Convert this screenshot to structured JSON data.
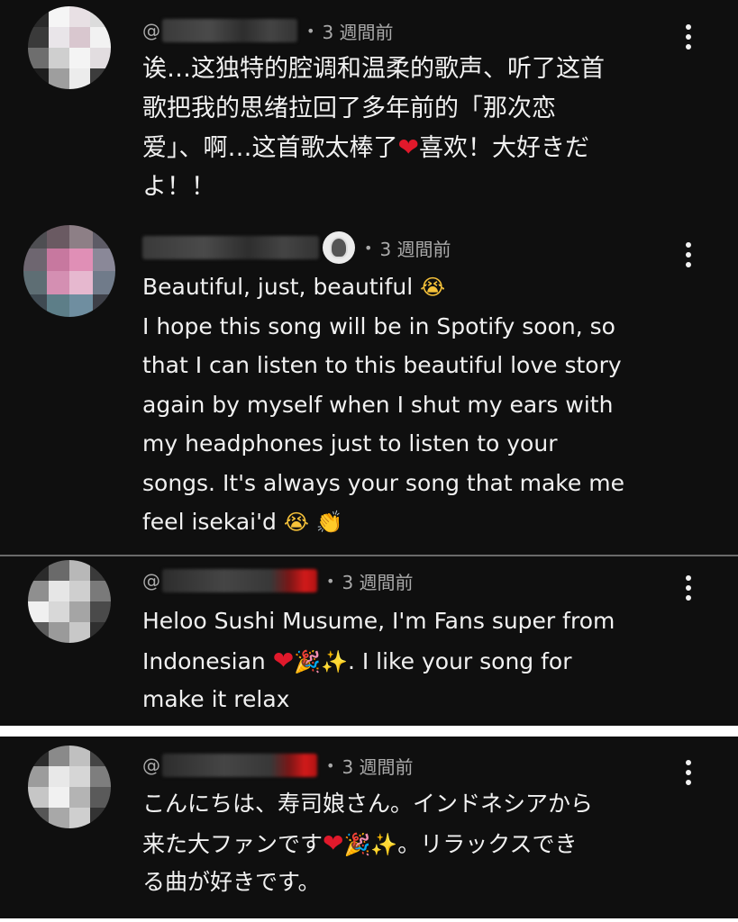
{
  "comments": [
    {
      "at": "@",
      "time": "3 週間前",
      "lines": [
        "诶…这独特的腔调和温柔的歌声、听了这首",
        "歌把我的思绪拉回了多年前的「那次恋",
        "爱」、啊…这首歌太棒了",
        "よ！！"
      ],
      "line3_tail": "喜欢！大好きだ",
      "avatar_colors": [
        "#2a2a2a",
        "#f5f5f5",
        "#e8e0e4",
        "#dcdcdc",
        "#3a3a3a",
        "#e9e5e9",
        "#d9c7cf",
        "#f2f2f2",
        "#6e6e6e",
        "#cfcfcf",
        "#f4f4f4",
        "#e2dde0",
        "#1e1e1e",
        "#9e9e9e",
        "#ececec",
        "#3c3c3c"
      ]
    },
    {
      "time": "3 週間前",
      "lines": [
        "Beautiful, just, beautiful",
        "I hope this song will be in Spotify soon, so",
        "that I can listen to this beautiful love story",
        "again by myself when I shut my ears with",
        "my headphones just to listen to your",
        "songs. It's always your song that make me",
        "feel isekai'd"
      ],
      "avatar_colors": [
        "#4e4e52",
        "#6a5a62",
        "#8d7f86",
        "#5d5b66",
        "#6e6670",
        "#c7789f",
        "#e08fb6",
        "#8a8898",
        "#5e6e74",
        "#d48fb2",
        "#e6b8cf",
        "#707b8a",
        "#3f4a52",
        "#5d7e88",
        "#6f8ea0",
        "#3e4048"
      ]
    },
    {
      "at": "@",
      "time": "3 週間前",
      "lines": [
        "Heloo Sushi Musume, I'm Fans super from",
        "Indonesian",
        "make it relax"
      ],
      "line2_tail": ". I like your song for",
      "avatar_colors": [
        "#2b2b2b",
        "#6a6a6a",
        "#b8b8b8",
        "#3a3a3a",
        "#8f8f8f",
        "#e6e6e6",
        "#cfcfcf",
        "#7a7a7a",
        "#f0f0f0",
        "#d8d8d8",
        "#a5a5a5",
        "#4a4a4a",
        "#5c5c5c",
        "#9a9a9a",
        "#c8c8c8",
        "#2f2f2f"
      ]
    },
    {
      "at": "@",
      "time": "3 週間前",
      "lines": [
        "こんにちは、寿司娘さん。インドネシアから",
        "来た大ファンです",
        "る曲が好きです。"
      ],
      "line2_tail": "。リラックスでき",
      "avatar_colors": [
        "#2c2c2c",
        "#8a8a8a",
        "#c0c0c0",
        "#444444",
        "#9c9c9c",
        "#e8e8e8",
        "#d6d6d6",
        "#7e7e7e",
        "#c6c6c6",
        "#f1f1f1",
        "#b4b4b4",
        "#5a5a5a",
        "#565656",
        "#a8a8a8",
        "#cfcfcf",
        "#333333"
      ]
    }
  ],
  "icons": {
    "heart": "❤",
    "cry": "😭",
    "clap": "👏",
    "party": "🎉",
    "sparkles": "✨",
    "menu": "more-vert-icon"
  }
}
